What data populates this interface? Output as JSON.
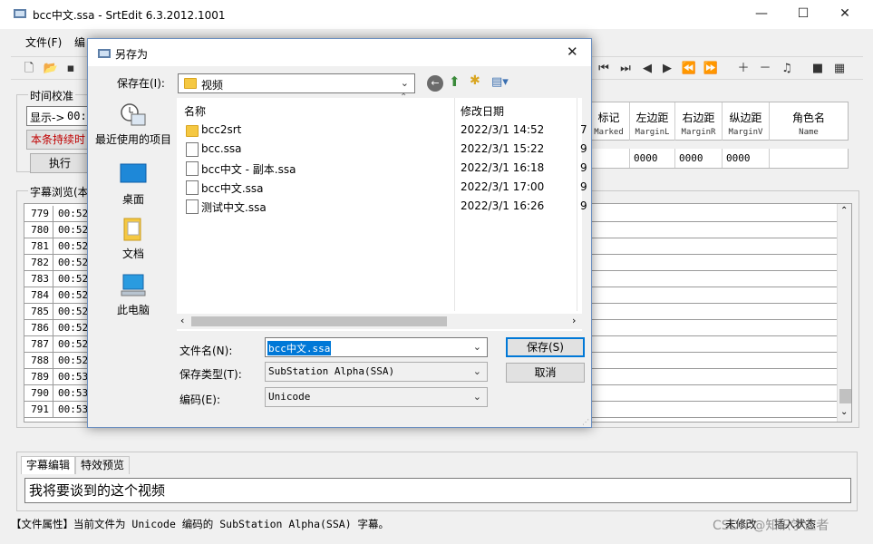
{
  "window": {
    "title": "bcc中文.ssa - SrtEdit 6.3.2012.1001",
    "minimize": "—",
    "maximize": "☐",
    "close": "✕"
  },
  "menu": {
    "items": [
      "文件(F)",
      "编"
    ]
  },
  "toolbar": {
    "icons": [
      "new-file-icon",
      "open-folder-icon",
      "save-icon",
      "skip-first-icon",
      "skip-last-icon",
      "prev-icon",
      "next-icon",
      "rewind-icon",
      "fast-forward-icon",
      "add-icon",
      "remove-icon",
      "music-icon",
      "film-icon",
      "clapper-icon"
    ]
  },
  "timing": {
    "group_label": "时间校准",
    "display_label": "显示->",
    "display_value": "00:0",
    "continue_button": "本条持续时",
    "execute_button": "执行"
  },
  "style_grid": {
    "columns": [
      {
        "cn": "标记",
        "en": "Marked"
      },
      {
        "cn": "左边距",
        "en": "MarginL"
      },
      {
        "cn": "右边距",
        "en": "MarginR"
      },
      {
        "cn": "纵边距",
        "en": "MarginV"
      },
      {
        "cn": "角色名",
        "en": "Name"
      }
    ],
    "row": [
      "",
      "0000",
      "0000",
      "0000",
      ""
    ]
  },
  "subtitle_browse": {
    "group_label": "字幕浏览(本",
    "rows": [
      {
        "n": "779",
        "t": "00:52"
      },
      {
        "n": "780",
        "t": "00:52"
      },
      {
        "n": "781",
        "t": "00:52"
      },
      {
        "n": "782",
        "t": "00:52"
      },
      {
        "n": "783",
        "t": "00:52"
      },
      {
        "n": "784",
        "t": "00:52"
      },
      {
        "n": "785",
        "t": "00:52"
      },
      {
        "n": "786",
        "t": "00:52"
      },
      {
        "n": "787",
        "t": "00:52"
      },
      {
        "n": "788",
        "t": "00:52"
      },
      {
        "n": "789",
        "t": "00:53"
      },
      {
        "n": "790",
        "t": "00:53"
      },
      {
        "n": "791",
        "t": "00:53"
      }
    ]
  },
  "dialog": {
    "title": "另存为",
    "save_in_label": "保存在(I):",
    "save_in_value": "视频",
    "places": [
      "最近使用的项目",
      "桌面",
      "文档",
      "此电脑"
    ],
    "col_name": "名称",
    "col_date": "修改日期",
    "files": [
      {
        "name": "bcc2srt",
        "date": "2022/3/1 14:52",
        "type": "folder",
        "extra": "7"
      },
      {
        "name": "bcc.ssa",
        "date": "2022/3/1 15:22",
        "type": "file",
        "extra": "9"
      },
      {
        "name": "bcc中文 - 副本.ssa",
        "date": "2022/3/1 16:18",
        "type": "file",
        "extra": "9"
      },
      {
        "name": "bcc中文.ssa",
        "date": "2022/3/1 17:00",
        "type": "file",
        "extra": "9"
      },
      {
        "name": "测试中文.ssa",
        "date": "2022/3/1 16:26",
        "type": "file",
        "extra": "9"
      }
    ],
    "filename_label": "文件名(N):",
    "filename_value": "bcc中文.ssa",
    "filetype_label": "保存类型(T):",
    "filetype_value": "SubStation Alpha(SSA)",
    "encoding_label": "编码(E):",
    "encoding_value": "Unicode",
    "save_button": "保存(S)",
    "cancel_button": "取消"
  },
  "edit": {
    "tab_edit": "字幕编辑",
    "tab_preview": "特效预览",
    "text": "我将要谈到的这个视频"
  },
  "status": {
    "text": "【文件属性】当前文件为 Unicode 编码的 SubStation Alpha(SSA) 字幕。",
    "modified": "未修改",
    "insert_mode": "插入状态"
  },
  "watermark": "CSDN @知识学业者"
}
